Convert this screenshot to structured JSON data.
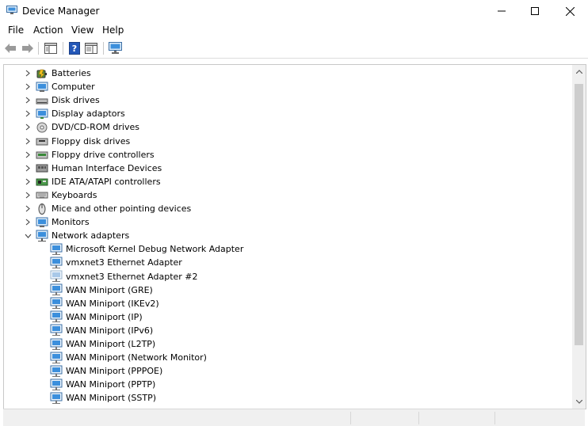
{
  "window": {
    "title": "Device Manager",
    "controls": [
      "minimize",
      "maximize",
      "close"
    ]
  },
  "menu": {
    "items": [
      "File",
      "Action",
      "View",
      "Help"
    ]
  },
  "toolbar": {
    "icons": [
      "back-arrow-icon",
      "forward-arrow-icon",
      "show-hide-console-tree-icon",
      "help-icon",
      "properties-icon",
      "scan-hardware-icon"
    ]
  },
  "tree": {
    "categories": [
      {
        "label": "Batteries",
        "icon": "battery-icon",
        "expanded": false
      },
      {
        "label": "Computer",
        "icon": "computer-icon",
        "expanded": false
      },
      {
        "label": "Disk drives",
        "icon": "disk-drive-icon",
        "expanded": false
      },
      {
        "label": "Display adaptors",
        "icon": "display-adapter-icon",
        "expanded": false
      },
      {
        "label": "DVD/CD-ROM drives",
        "icon": "dvd-drive-icon",
        "expanded": false
      },
      {
        "label": "Floppy disk drives",
        "icon": "floppy-disk-icon",
        "expanded": false
      },
      {
        "label": "Floppy drive controllers",
        "icon": "floppy-controller-icon",
        "expanded": false
      },
      {
        "label": "Human Interface Devices",
        "icon": "hid-icon",
        "expanded": false
      },
      {
        "label": "IDE ATA/ATAPI controllers",
        "icon": "ide-controller-icon",
        "expanded": false
      },
      {
        "label": "Keyboards",
        "icon": "keyboard-icon",
        "expanded": false
      },
      {
        "label": "Mice and other pointing devices",
        "icon": "mouse-icon",
        "expanded": false
      },
      {
        "label": "Monitors",
        "icon": "monitor-icon",
        "expanded": false
      },
      {
        "label": "Network adapters",
        "icon": "network-adapter-icon",
        "expanded": true
      }
    ],
    "network_adapters": [
      {
        "label": "Microsoft Kernel Debug Network Adapter",
        "disabled": false
      },
      {
        "label": "vmxnet3 Ethernet Adapter",
        "disabled": false
      },
      {
        "label": "vmxnet3 Ethernet Adapter #2",
        "disabled": true
      },
      {
        "label": "WAN Miniport (GRE)",
        "disabled": false
      },
      {
        "label": "WAN Miniport (IKEv2)",
        "disabled": false
      },
      {
        "label": "WAN Miniport (IP)",
        "disabled": false
      },
      {
        "label": "WAN Miniport (IPv6)",
        "disabled": false
      },
      {
        "label": "WAN Miniport (L2TP)",
        "disabled": false
      },
      {
        "label": "WAN Miniport (Network Monitor)",
        "disabled": false
      },
      {
        "label": "WAN Miniport (PPPOE)",
        "disabled": false
      },
      {
        "label": "WAN Miniport (PPTP)",
        "disabled": false
      },
      {
        "label": "WAN Miniport (SSTP)",
        "disabled": false
      }
    ]
  },
  "colors": {
    "accent": "#2b7bd4",
    "icon_blue": "#3c8fdc",
    "icon_disabled": "#a8c8e8"
  }
}
